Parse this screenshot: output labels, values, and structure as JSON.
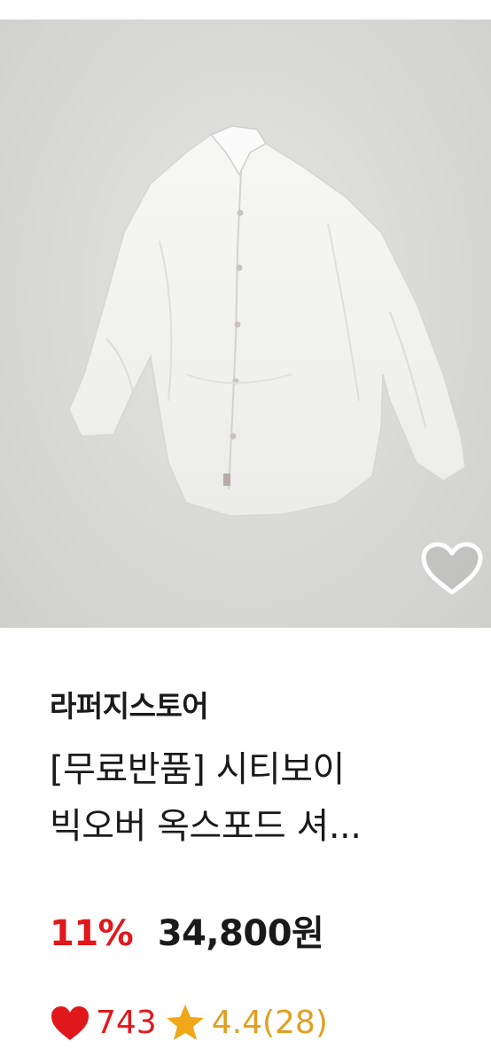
{
  "product": {
    "store_name": "라퍼지스토어",
    "title_line1": "[무료반품] 시티보이",
    "title_line2": "빅오버 옥스포드 셔...",
    "discount": "11%",
    "price": "34,800원",
    "like_count": "743",
    "rating": "4.4(28)"
  },
  "icons": {
    "wishlist": "heart-outline-icon",
    "like": "heart-filled-icon",
    "rating": "star-icon"
  },
  "colors": {
    "discount": "#e0181c",
    "price": "#1a1a1a",
    "rating": "#e0a020",
    "like": "#e0181c"
  }
}
